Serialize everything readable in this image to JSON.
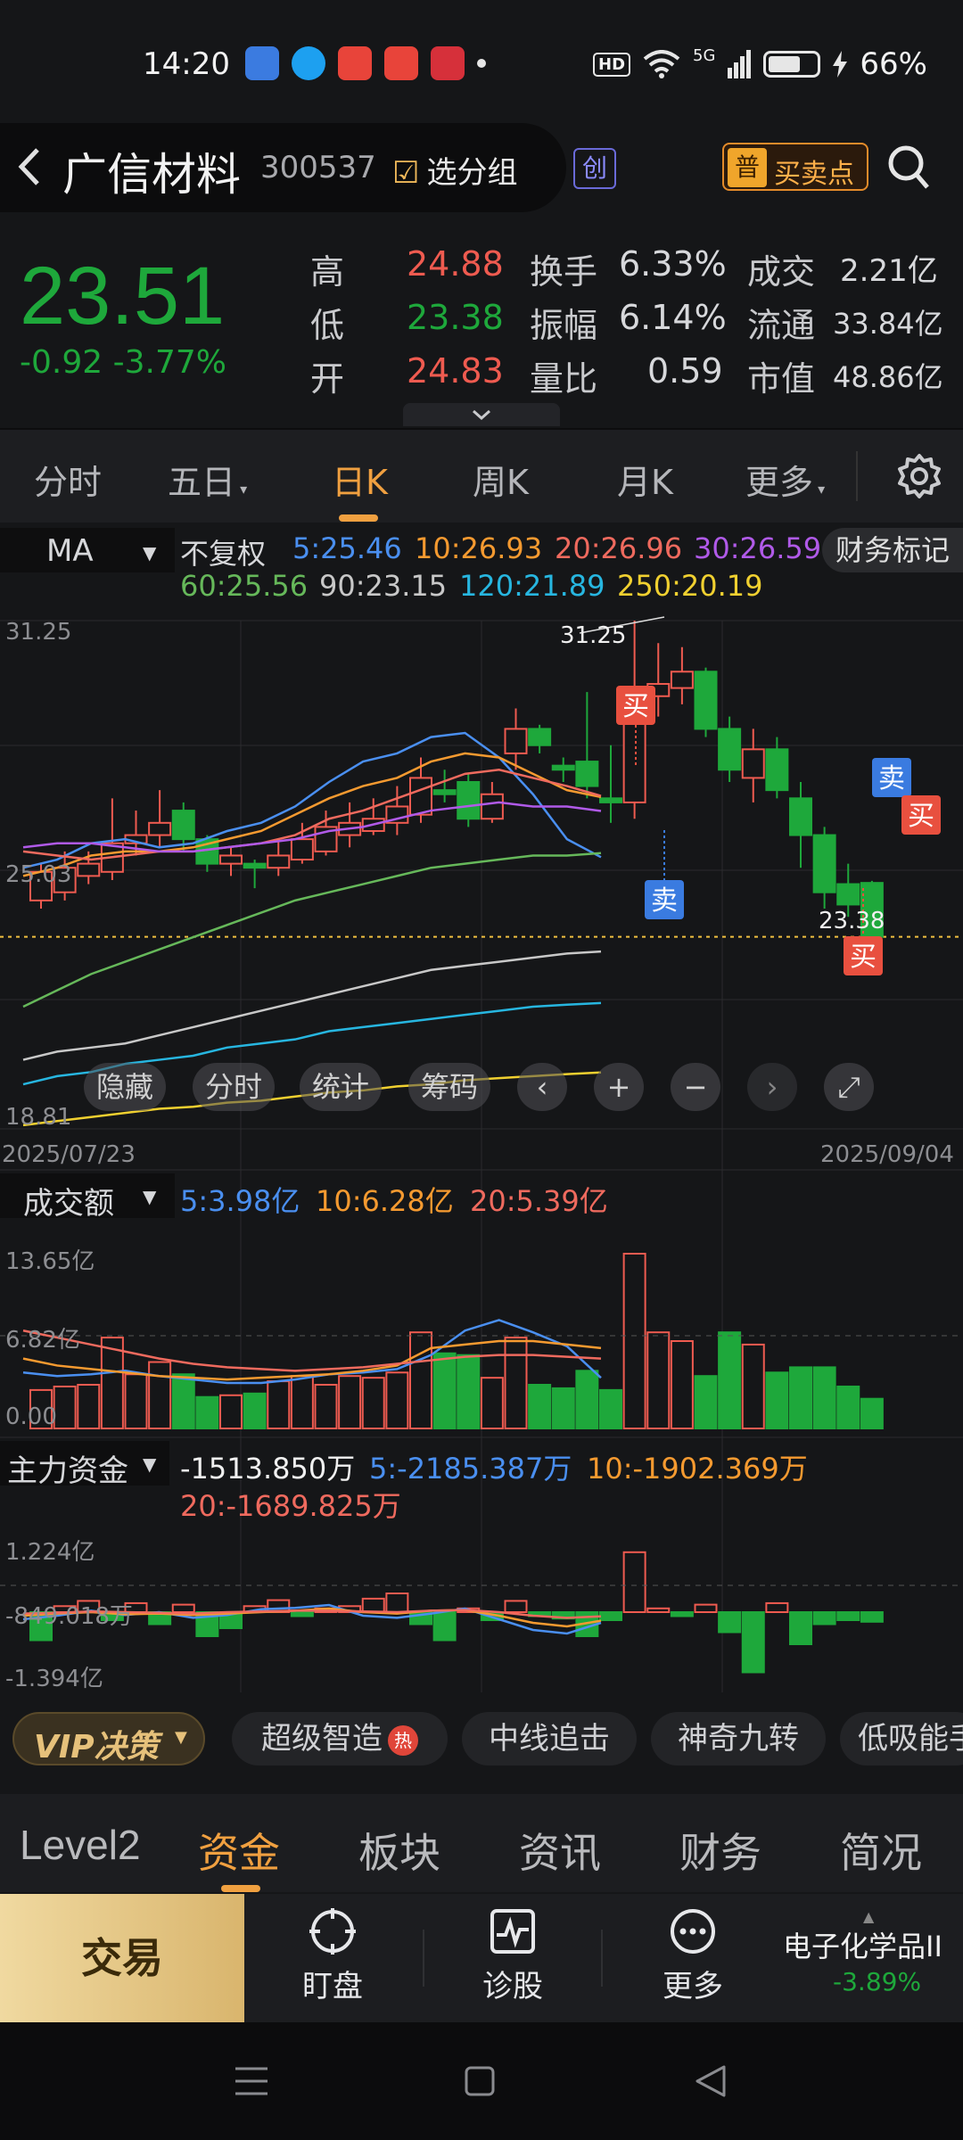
{
  "status": {
    "time": "14:20",
    "hd": "HD",
    "network": "5G",
    "battery": "66%",
    "battery_level": 0.66
  },
  "header": {
    "name": "广信材料",
    "code": "300537",
    "group_label": "选分组",
    "board_badge": "创",
    "buysell_badge": "普",
    "buysell_label": "买卖点"
  },
  "quote": {
    "price": "23.51",
    "change": "-0.92",
    "change_pct": "-3.77%",
    "rows": [
      {
        "k1": "高",
        "v1": "24.88",
        "k2": "换手",
        "v2": "6.33%",
        "k3": "成交",
        "v3": "2.21亿"
      },
      {
        "k1": "低",
        "v1": "23.38",
        "k2": "振幅",
        "v2": "6.14%",
        "k3": "流通",
        "v3": "33.84亿"
      },
      {
        "k1": "开",
        "v1": "24.83",
        "k2": "量比",
        "v2": "0.59",
        "k3": "市值",
        "v3": "48.86亿"
      }
    ]
  },
  "tabs": {
    "t1": "分时",
    "t2": "五日",
    "t3": "日K",
    "t4": "周K",
    "t5": "月K",
    "t6": "更多"
  },
  "ma": {
    "selector": "MA",
    "adjust": "不复权",
    "fin": "财务标记",
    "ma5": "5:25.46",
    "ma10": "10:26.93",
    "ma20": "20:26.96",
    "ma30": "30:26.59",
    "ma60": "60:25.56",
    "ma90": "90:23.15",
    "ma120": "120:21.89",
    "ma250": "250:20.19"
  },
  "colors": {
    "up": "#ef5b50",
    "down": "#1ea83b",
    "ma5": "#4a8ff0",
    "ma10": "#f59a30",
    "ma20": "#ef6a5e",
    "ma30": "#b05ae8",
    "ma60": "#66b85a",
    "ma90": "#c8c8c8",
    "ma120": "#27b6e0",
    "ma250": "#f0d030"
  },
  "kline_axis": {
    "high": "31.25",
    "mid": "25.03",
    "low": "18.81",
    "start_date": "2025/07/23",
    "end_date": "2025/09/04",
    "peak_label": "31.25",
    "low_label": "23.38"
  },
  "chart_controls": {
    "hide": "隐藏",
    "intraday": "分时",
    "stats": "统计",
    "chips": "筹码"
  },
  "signals": {
    "buy": "买",
    "sell": "卖"
  },
  "volume": {
    "label": "成交额",
    "ma5": "5:3.98亿",
    "ma10": "10:6.28亿",
    "ma20": "20:5.39亿",
    "top": "13.65亿",
    "mid": "6.82亿",
    "bottom": "0.00"
  },
  "capital": {
    "label": "主力资金",
    "value": "-1513.850万",
    "ma5": "5:-2185.387万",
    "ma10": "10:-1902.369万",
    "ma20": "20:-1689.825万",
    "top": "1.224亿",
    "mid": "-849.018万",
    "bottom": "-1.394亿"
  },
  "strategies": {
    "vip": "VIP决策",
    "c1": "超级智造",
    "hot": "热",
    "c2": "中线追击",
    "c3": "神奇九转",
    "c4": "低吸能手"
  },
  "info_tabs": {
    "t1": "Level2",
    "t2": "资金",
    "t3": "板块",
    "t4": "资讯",
    "t5": "财务",
    "t6": "简况"
  },
  "actions": {
    "trade": "交易",
    "watch": "盯盘",
    "diagnose": "诊股",
    "more": "更多"
  },
  "sector": {
    "name": "电子化学品II",
    "pct": "-3.89%"
  },
  "chart_data": {
    "type": "candlestick",
    "title": "日K",
    "x_range": [
      "2025/07/23",
      "2025/09/04"
    ],
    "ylim": [
      18.81,
      31.25
    ],
    "last_close": 23.51,
    "period_high": 31.25,
    "period_low_today": 23.38,
    "moving_averages": {
      "MA5": 25.46,
      "MA10": 26.93,
      "MA20": 26.96,
      "MA30": 26.59,
      "MA60": 25.56,
      "MA90": 23.15,
      "MA120": 21.89,
      "MA250": 20.19
    },
    "turnover_ma": {
      "MA5": "3.98亿",
      "MA10": "6.28亿",
      "MA20": "5.39亿"
    },
    "capital_flow": {
      "today": "-1513.850万",
      "MA5": "-2185.387万",
      "MA10": "-1902.369万",
      "MA20": "-1689.825万"
    }
  }
}
